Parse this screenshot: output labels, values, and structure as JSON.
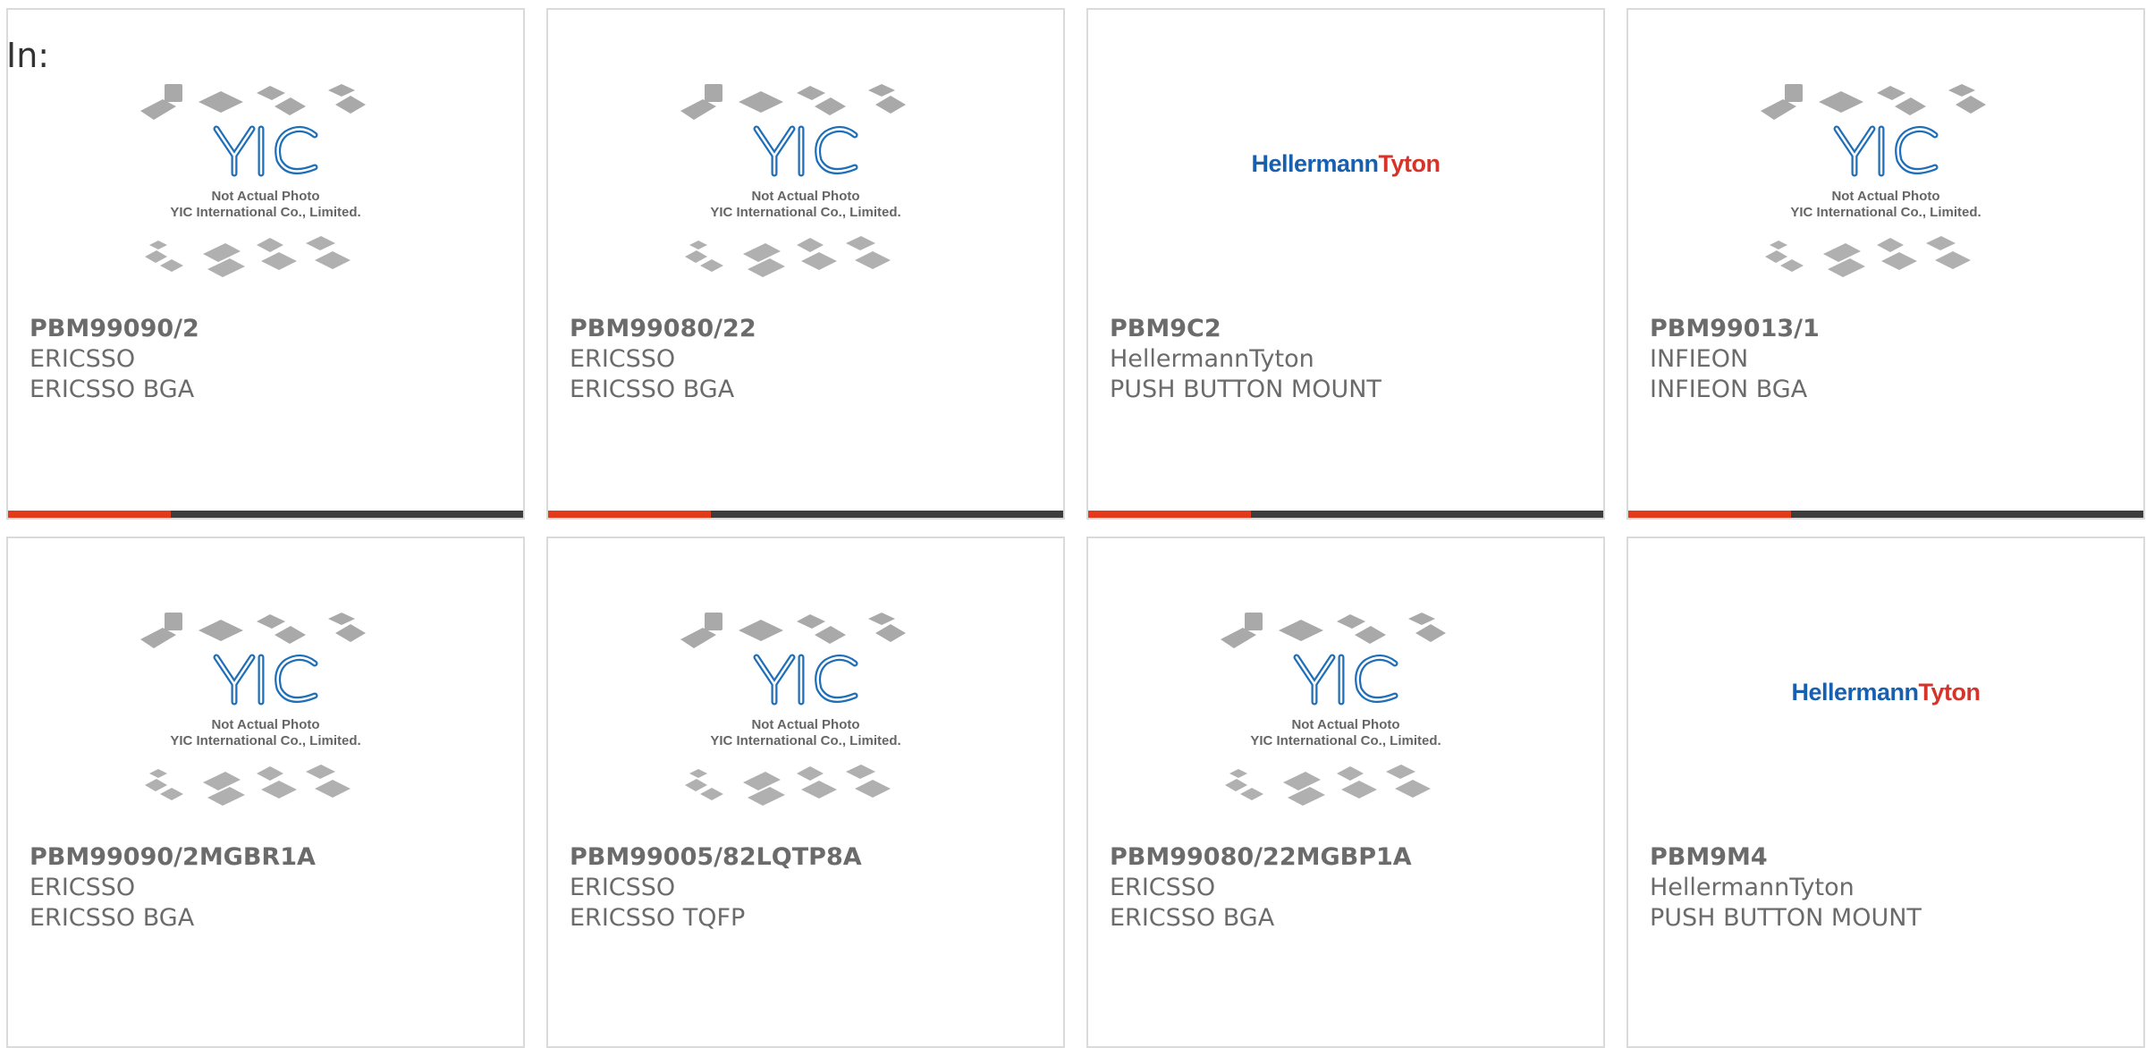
{
  "header": {
    "label": "In:"
  },
  "placeholder": {
    "line1": "Not Actual Photo",
    "line2": "YIC International Co., Limited.",
    "logo_text": "YIC"
  },
  "ht_logo": {
    "part1": "Hellermann",
    "part2": "Tyton"
  },
  "products": [
    {
      "pn": "PBM99090/2",
      "mfr": "ERICSSO",
      "desc": "ERICSSO BGA",
      "image": "yic-placeholder"
    },
    {
      "pn": "PBM99080/22",
      "mfr": "ERICSSO",
      "desc": "ERICSSO BGA",
      "image": "yic-placeholder"
    },
    {
      "pn": "PBM9C2",
      "mfr": "HellermannTyton",
      "desc": "PUSH BUTTON MOUNT",
      "image": "hellermanntyton-logo"
    },
    {
      "pn": "PBM99013/1",
      "mfr": "INFIEON",
      "desc": "INFIEON BGA",
      "image": "yic-placeholder"
    },
    {
      "pn": "PBM99090/2MGBR1A",
      "mfr": "ERICSSO",
      "desc": "ERICSSO BGA",
      "image": "yic-placeholder"
    },
    {
      "pn": "PBM99005/82LQTP8A",
      "mfr": "ERICSSO",
      "desc": "ERICSSO TQFP",
      "image": "yic-placeholder"
    },
    {
      "pn": "PBM99080/22MGBP1A",
      "mfr": "ERICSSO",
      "desc": "ERICSSO BGA",
      "image": "yic-placeholder"
    },
    {
      "pn": "PBM9M4",
      "mfr": "HellermannTyton",
      "desc": "PUSH BUTTON MOUNT",
      "image": "hellermanntyton-logo"
    }
  ],
  "colors": {
    "accent": "#e23a1b",
    "bar": "#3d3d3d",
    "border": "#dadada",
    "text": "#6b6b6b",
    "yic_blue": "#2a8fd0"
  }
}
